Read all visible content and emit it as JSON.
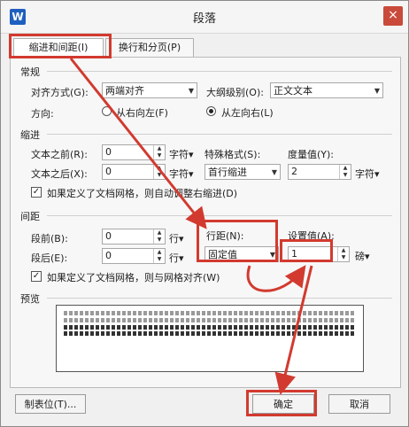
{
  "window": {
    "title": "段落",
    "app_icon": "W",
    "close": "×"
  },
  "tabs": [
    {
      "label": "缩进和间距(I)"
    },
    {
      "label": "换行和分页(P)"
    }
  ],
  "general": {
    "section": "常规",
    "alignment_label": "对齐方式(G):",
    "alignment_value": "两端对齐",
    "outline_label": "大纲级别(O):",
    "outline_value": "正文文本",
    "direction_label": "方向:",
    "rtl_label": "从右向左(F)",
    "ltr_label": "从左向右(L)"
  },
  "indent": {
    "section": "缩进",
    "before_label": "文本之前(R):",
    "before_value": "0",
    "before_unit": "字符▾",
    "after_label": "文本之后(X):",
    "after_value": "0",
    "after_unit": "字符▾",
    "special_label": "特殊格式(S):",
    "special_value": "首行缩进",
    "measure_label": "度量值(Y):",
    "measure_value": "2",
    "measure_unit": "字符▾",
    "auto_adjust": "如果定义了文档网格，则自动调整右缩进(D)"
  },
  "spacing": {
    "section": "间距",
    "before_label": "段前(B):",
    "before_value": "0",
    "before_unit": "行▾",
    "after_label": "段后(E):",
    "after_value": "0",
    "after_unit": "行▾",
    "line_label": "行距(N):",
    "line_value": "固定值",
    "set_label": "设置值(A):",
    "set_value": "1",
    "set_unit": "磅▾",
    "snap_grid": "如果定义了文档网格，则与网格对齐(W)"
  },
  "preview": {
    "section": "预览"
  },
  "buttons": {
    "tabs": "制表位(T)...",
    "ok": "确定",
    "cancel": "取消"
  },
  "colors": {
    "annotation": "#d23a2f"
  }
}
